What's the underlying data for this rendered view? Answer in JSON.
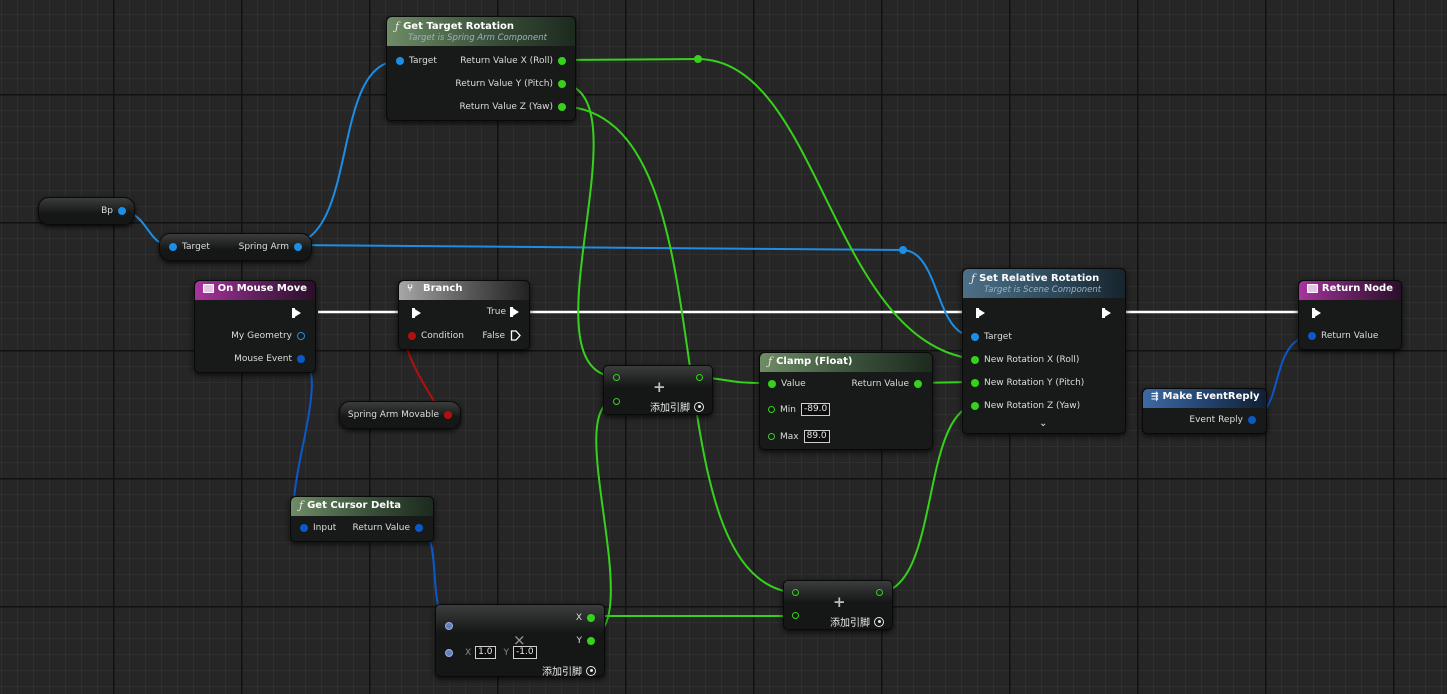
{
  "nodes": {
    "get_target_rotation": {
      "title": "Get Target Rotation",
      "subtitle": "Target is Spring Arm Component",
      "pin_target": "Target",
      "pin_x": "Return Value X (Roll)",
      "pin_y": "Return Value Y (Pitch)",
      "pin_z": "Return Value Z (Yaw)"
    },
    "bp": {
      "label": "Bp"
    },
    "spring_arm_getter": {
      "pin_target": "Target",
      "pin_out": "Spring Arm"
    },
    "on_mouse_move": {
      "title": "On Mouse Move",
      "pin_geometry": "My Geometry",
      "pin_event": "Mouse Event"
    },
    "branch": {
      "title": "Branch",
      "pin_condition": "Condition",
      "pin_true": "True",
      "pin_false": "False"
    },
    "spring_arm_movable": {
      "label": "Spring Arm Movable"
    },
    "add_top": {
      "add_pin_label": "添加引脚"
    },
    "clamp": {
      "title": "Clamp (Float)",
      "pin_value": "Value",
      "pin_return": "Return Value",
      "pin_min": "Min",
      "min_value": "-89.0",
      "pin_max": "Max",
      "max_value": "89.0"
    },
    "set_relative_rotation": {
      "title": "Set Relative Rotation",
      "subtitle": "Target is Scene Component",
      "pin_target": "Target",
      "pin_x": "New Rotation X (Roll)",
      "pin_y": "New Rotation Y (Pitch)",
      "pin_z": "New Rotation Z (Yaw)"
    },
    "return_node": {
      "title": "Return Node",
      "pin_return": "Return Value"
    },
    "make_event_reply": {
      "title": "Make EventReply",
      "pin_reply": "Event Reply"
    },
    "get_cursor_delta": {
      "title": "Get Cursor Delta",
      "pin_input": "Input",
      "pin_return": "Return Value"
    },
    "multiply": {
      "x_label": "X",
      "x_value": "1.0",
      "y_label": "Y",
      "y_value": "-1.0",
      "out_x": "X",
      "out_y": "Y",
      "add_pin_label": "添加引脚"
    },
    "add_bottom": {
      "add_pin_label": "添加引脚"
    }
  },
  "colors": {
    "background": "#262626",
    "float_wire": "#36d11b",
    "object_wire": "#1d8ee6",
    "bool_wire": "#b40f0f",
    "exec_wire": "#ffffff",
    "struct_wire": "#0b58c9",
    "function_header": "#6e8c65",
    "target_header": "#4d7088",
    "event_header": "#a9339e"
  },
  "icons": {
    "function": "function-f-icon",
    "event": "event-icon",
    "branch": "branch-icon",
    "make": "make-struct-icon",
    "add_pin": "add-pin-icon",
    "expand": "chevron-down-icon"
  }
}
